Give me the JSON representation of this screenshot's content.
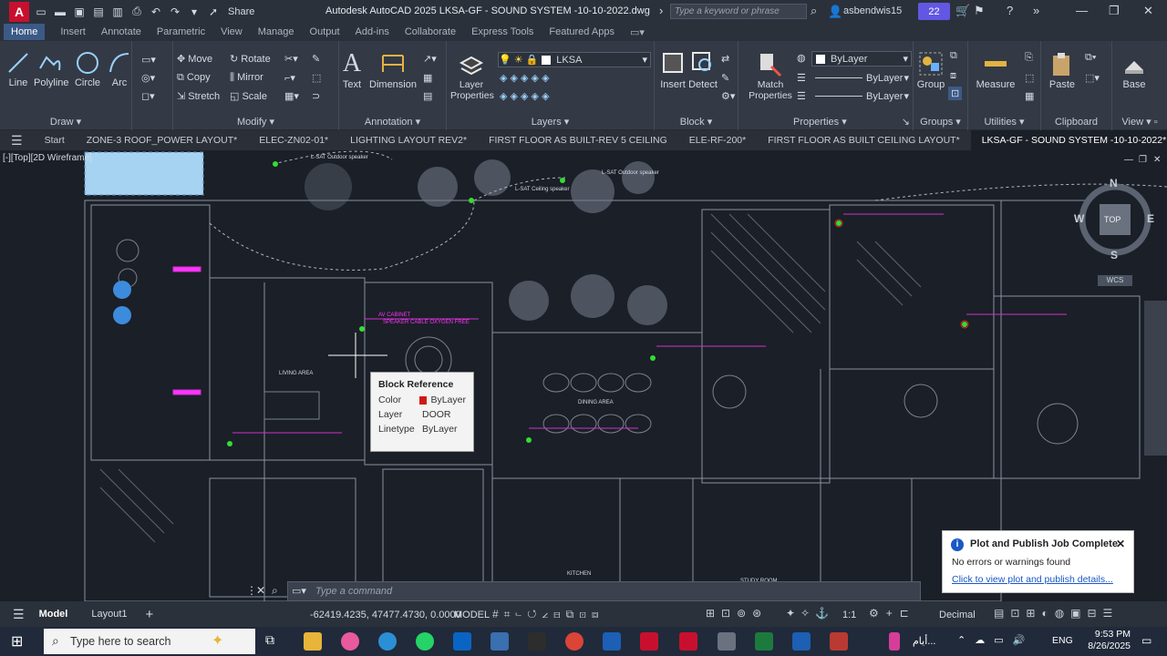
{
  "titlebar": {
    "app_letter": "A",
    "share": "Share",
    "title": "Autodesk AutoCAD 2025   LKSA-GF - SOUND SYSTEM -10-10-2022.dwg",
    "search_placeholder": "Type a keyword or phrase",
    "user": "asbendwis15",
    "badge": "22"
  },
  "menu": {
    "items": [
      "Home",
      "Insert",
      "Annotate",
      "Parametric",
      "View",
      "Manage",
      "Output",
      "Add-ins",
      "Collaborate",
      "Express Tools",
      "Featured Apps"
    ]
  },
  "ribbon": {
    "draw": {
      "title": "Draw",
      "line": "Line",
      "polyline": "Polyline",
      "circle": "Circle",
      "arc": "Arc"
    },
    "modify": {
      "title": "Modify",
      "move": "Move",
      "rotate": "Rotate",
      "copy": "Copy",
      "mirror": "Mirror",
      "stretch": "Stretch",
      "scale": "Scale"
    },
    "annotation": {
      "title": "Annotation",
      "text": "Text",
      "dimension": "Dimension"
    },
    "layers": {
      "title": "Layers",
      "layer_properties": "Layer Properties",
      "current_layer": "LKSA"
    },
    "block": {
      "title": "Block",
      "insert": "Insert",
      "detect": "Detect"
    },
    "properties": {
      "title": "Properties",
      "match": "Match Properties",
      "color": "ByLayer",
      "lineweight": "ByLayer",
      "linetype": "ByLayer"
    },
    "groups": {
      "title": "Groups",
      "group": "Group"
    },
    "utilities": {
      "title": "Utilities",
      "measure": "Measure"
    },
    "clipboard": {
      "title": "Clipboard",
      "paste": "Paste"
    },
    "view": {
      "title": "View",
      "base": "Base"
    }
  },
  "file_tabs": {
    "start": "Start",
    "tabs": [
      "ZONE-3 ROOF_POWER LAYOUT*",
      "ELEC-ZN02-01*",
      "LIGHTING LAYOUT REV2*",
      "FIRST FLOOR AS BUILT-REV 5 CEILING",
      "ELE-RF-200*",
      "FIRST FLOOR AS BUILT CEILING LAYOUT*",
      "LKSA-GF - SOUND SYSTEM -10-10-2022*"
    ]
  },
  "viewport": {
    "label": "[-][Top][2D Wireframe]"
  },
  "viewcube": {
    "n": "N",
    "s": "S",
    "e": "E",
    "w": "W",
    "top": "TOP",
    "wcs": "WCS"
  },
  "tooltip": {
    "title": "Block Reference",
    "color_k": "Color",
    "color_v": "ByLayer",
    "layer_k": "Layer",
    "layer_v": "DOOR",
    "linetype_k": "Linetype",
    "linetype_v": "ByLayer"
  },
  "drawing_labels": {
    "l1": "L-SAT Outdoor speaker",
    "l2": "L-SAT Ceiling speaker",
    "l3": "L-SAT Outdoor speaker",
    "l4": "AV CABINET",
    "l5": "SPEAKER CABLE OXYGEN FREE",
    "l6": "DINING AREA",
    "l7": "LIVING AREA",
    "l8": "KITCHEN",
    "l9": "STUDY ROOM"
  },
  "notify": {
    "title": "Plot and Publish Job Complete",
    "message": "No errors or warnings found",
    "link": "Click to view plot and publish details..."
  },
  "command": {
    "placeholder": "Type a command"
  },
  "status": {
    "model_tab": "Model",
    "layout_tab": "Layout1",
    "coords": "-62419.4235, 47477.4730, 0.0000",
    "model": "MODEL",
    "scale": "1:1",
    "units": "Decimal"
  },
  "taskbar": {
    "search": "Type here to search",
    "arabic": "أيام...",
    "lang": "ENG",
    "time": "9:53 PM",
    "date": "8/26/2025"
  }
}
